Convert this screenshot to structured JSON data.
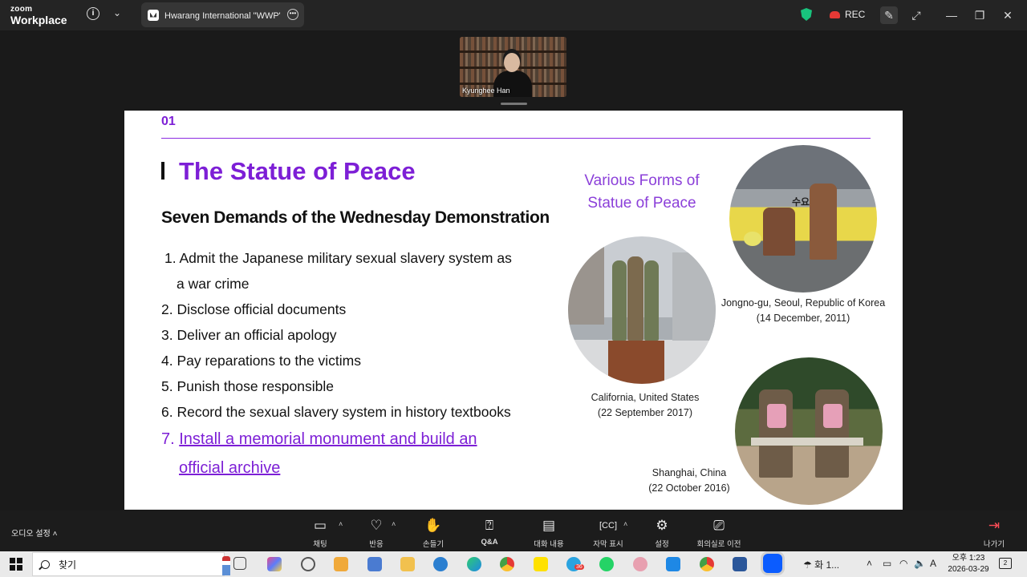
{
  "titlebar": {
    "brand_small": "zoom",
    "brand_big": "Workplace",
    "tab_title": "Hwarang International \"WWP\"의",
    "rec_label": "REC"
  },
  "video": {
    "participant_name": "Kyunghee Han"
  },
  "slide": {
    "number": "01",
    "title": "The Statue of Peace",
    "subtitle": "Seven Demands of the Wednesday Demonstration",
    "demands": [
      "1. Admit the Japanese military sexual slavery system as",
      "a war crime",
      "2. Disclose official documents",
      "3. Deliver an official apology",
      "4. Pay reparations to the victims",
      "5. Punish those responsible",
      "6. Record the sexual slavery system in history textbooks"
    ],
    "demand7_num": "7.",
    "demand7_line1": "Install a memorial monument and build an",
    "demand7_line2": "official archive",
    "forms_title_1": "Various Forms of",
    "forms_title_2": "Statue of Peace",
    "photo_sign_text": "수요 하다",
    "captions": {
      "seoul_1": "Jongno-gu, Seoul, Republic of Korea",
      "seoul_2": "(14 December, 2011)",
      "california_1": "California, United States",
      "california_2": "(22 September 2017)",
      "shanghai_1": "Shanghai, China",
      "shanghai_2": "(22 October 2016)"
    }
  },
  "toolbar": {
    "audio_settings": "오디오 설정",
    "chat": "채팅",
    "reactions": "반응",
    "raise_hand": "손들기",
    "qa": "Q&A",
    "transcript": "대화 내용",
    "captions": "자막 표시",
    "settings": "설정",
    "move_room": "회의실로 이전",
    "leave": "나가기"
  },
  "taskbar": {
    "search_label": "찾기",
    "weather": "화 1...",
    "clock_time": "오후 1:23",
    "clock_date": "2026-03-29",
    "notifications": "2",
    "telegram_badge": "36"
  },
  "colors": {
    "accent_purple": "#7d1fd6",
    "rec_red": "#e53935",
    "shield_green": "#19c37d"
  }
}
